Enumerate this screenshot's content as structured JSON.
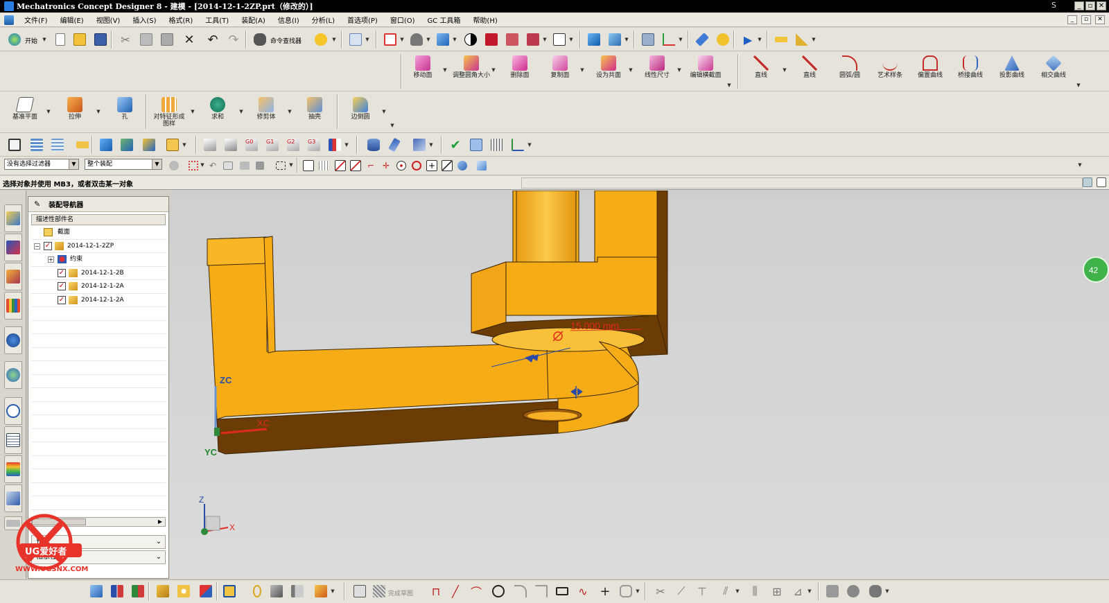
{
  "window": {
    "title": "Mechatronics Concept Designer 8 - 建模 - [2014-12-1-2ZP.prt（修改的）]",
    "minimize": "_",
    "restore": "▫",
    "close": "✕",
    "letter": "S"
  },
  "menu": {
    "items": [
      "文件(F)",
      "编辑(E)",
      "视图(V)",
      "插入(S)",
      "格式(R)",
      "工具(T)",
      "装配(A)",
      "信息(I)",
      "分析(L)",
      "首选项(P)",
      "窗口(O)",
      "GC 工具箱",
      "帮助(H)"
    ]
  },
  "toolbar_standard": {
    "start_label": "开始",
    "command_finder_label": "命令查找器"
  },
  "toolbar_sync": {
    "buttons": [
      "移动面",
      "调整圆角大小",
      "删除面",
      "复制面",
      "设为共面",
      "线性尺寸",
      "编辑横截面"
    ]
  },
  "toolbar_curve": {
    "buttons": [
      "直线",
      "直线",
      "圆弧/圆",
      "艺术样条",
      "偏置曲线",
      "桥接曲线",
      "投影曲线",
      "相交曲线"
    ]
  },
  "toolbar_feature": {
    "buttons": [
      "基准平面",
      "拉伸",
      "孔",
      "对特征形成图样",
      "求和",
      "修剪体",
      "抽壳",
      "边倒圆"
    ]
  },
  "selection_bar": {
    "type_filter": "没有选择过滤器",
    "scope": "整个装配"
  },
  "cue_line": "选择对象并使用 MB3，或者双击某一对象",
  "navigator": {
    "title": "装配导航器",
    "column_header": "描述性部件名",
    "rows": [
      {
        "label": "截面"
      },
      {
        "label": "2014-12-1-2ZP"
      },
      {
        "label": "约束"
      },
      {
        "label": "2014-12-1-2B"
      },
      {
        "label": "2014-12-1-2A"
      },
      {
        "label": "2014-12-1-2A"
      }
    ],
    "preview_label": "预览",
    "dependencies_label": "相依性"
  },
  "viewport": {
    "dimension_label": "15.000 mm",
    "wcs_labels": {
      "z": "ZC",
      "x": "XC",
      "y": "YC"
    },
    "abs_labels": {
      "z": "Z",
      "x": "X"
    },
    "side_badge": "42"
  },
  "watermark": {
    "text": "UG爱好者",
    "url": "WWW.UGSNX.COM"
  },
  "bottom_toolbar": {
    "sketch_label": "完成草图"
  },
  "colors": {
    "part_orange": "#f5ac17",
    "part_shadow": "#6b3c06",
    "dimension_red": "#e02a1c",
    "blue_arrow": "#2a4aa8"
  }
}
